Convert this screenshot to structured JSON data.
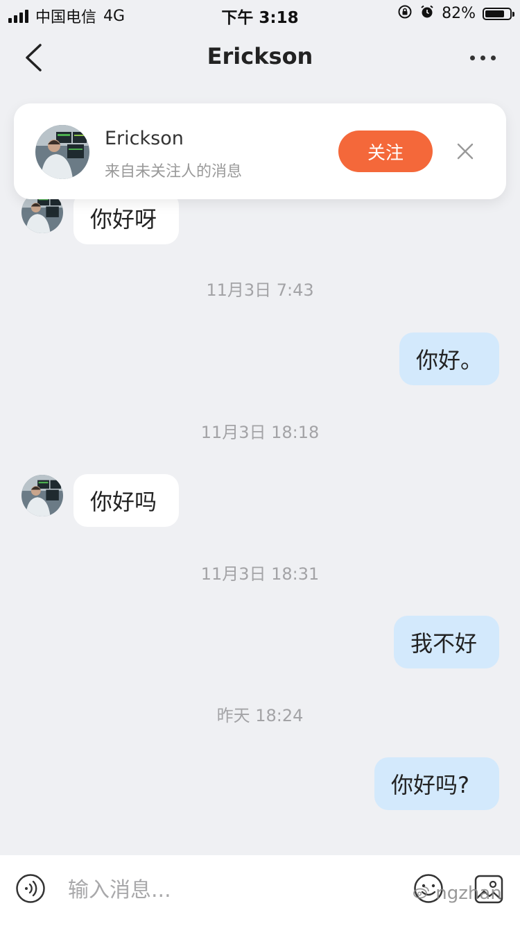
{
  "status_bar": {
    "carrier": "中国电信",
    "network": "4G",
    "time": "下午 3:18",
    "battery": "82%",
    "battery_level": 0.82
  },
  "header": {
    "title": "Erickson"
  },
  "follow_card": {
    "name": "Erickson",
    "subtitle": "来自未关注人的消息",
    "follow_label": "关注"
  },
  "messages": [
    {
      "side": "incoming",
      "text": "你好呀"
    },
    {
      "type": "timestamp",
      "text": "11月3日 7:43"
    },
    {
      "side": "outgoing",
      "text": "你好。"
    },
    {
      "type": "timestamp",
      "text": "11月3日 18:18"
    },
    {
      "side": "incoming",
      "text": "你好吗"
    },
    {
      "type": "timestamp",
      "text": "11月3日 18:31"
    },
    {
      "side": "outgoing",
      "text": "我不好"
    },
    {
      "type": "timestamp",
      "text": "昨天 18:24"
    },
    {
      "side": "outgoing",
      "text": "你好吗?"
    }
  ],
  "input_bar": {
    "placeholder": "输入消息...",
    "value": ""
  },
  "watermark": "ngzhan",
  "colors": {
    "accent": "#f4683a",
    "outgoing_bubble": "#d3e9fc",
    "background": "#eff0f3"
  }
}
